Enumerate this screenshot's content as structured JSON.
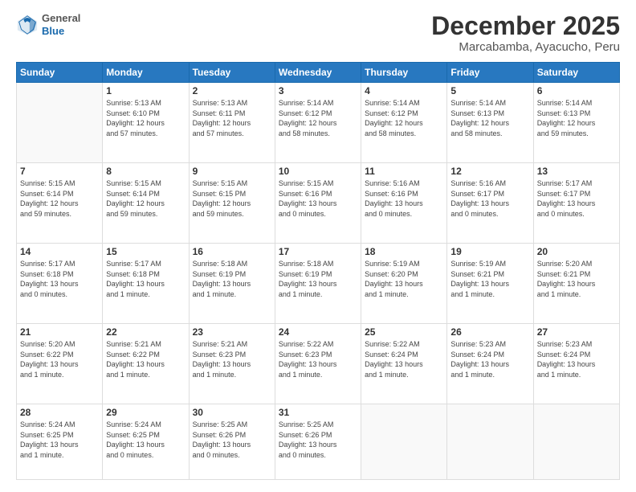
{
  "logo": {
    "general": "General",
    "blue": "Blue"
  },
  "header": {
    "month": "December 2025",
    "location": "Marcabamba, Ayacucho, Peru"
  },
  "weekdays": [
    "Sunday",
    "Monday",
    "Tuesday",
    "Wednesday",
    "Thursday",
    "Friday",
    "Saturday"
  ],
  "weeks": [
    [
      {
        "day": "",
        "info": ""
      },
      {
        "day": "1",
        "info": "Sunrise: 5:13 AM\nSunset: 6:10 PM\nDaylight: 12 hours\nand 57 minutes."
      },
      {
        "day": "2",
        "info": "Sunrise: 5:13 AM\nSunset: 6:11 PM\nDaylight: 12 hours\nand 57 minutes."
      },
      {
        "day": "3",
        "info": "Sunrise: 5:14 AM\nSunset: 6:12 PM\nDaylight: 12 hours\nand 58 minutes."
      },
      {
        "day": "4",
        "info": "Sunrise: 5:14 AM\nSunset: 6:12 PM\nDaylight: 12 hours\nand 58 minutes."
      },
      {
        "day": "5",
        "info": "Sunrise: 5:14 AM\nSunset: 6:13 PM\nDaylight: 12 hours\nand 58 minutes."
      },
      {
        "day": "6",
        "info": "Sunrise: 5:14 AM\nSunset: 6:13 PM\nDaylight: 12 hours\nand 59 minutes."
      }
    ],
    [
      {
        "day": "7",
        "info": "Sunrise: 5:15 AM\nSunset: 6:14 PM\nDaylight: 12 hours\nand 59 minutes."
      },
      {
        "day": "8",
        "info": "Sunrise: 5:15 AM\nSunset: 6:14 PM\nDaylight: 12 hours\nand 59 minutes."
      },
      {
        "day": "9",
        "info": "Sunrise: 5:15 AM\nSunset: 6:15 PM\nDaylight: 12 hours\nand 59 minutes."
      },
      {
        "day": "10",
        "info": "Sunrise: 5:15 AM\nSunset: 6:16 PM\nDaylight: 13 hours\nand 0 minutes."
      },
      {
        "day": "11",
        "info": "Sunrise: 5:16 AM\nSunset: 6:16 PM\nDaylight: 13 hours\nand 0 minutes."
      },
      {
        "day": "12",
        "info": "Sunrise: 5:16 AM\nSunset: 6:17 PM\nDaylight: 13 hours\nand 0 minutes."
      },
      {
        "day": "13",
        "info": "Sunrise: 5:17 AM\nSunset: 6:17 PM\nDaylight: 13 hours\nand 0 minutes."
      }
    ],
    [
      {
        "day": "14",
        "info": "Sunrise: 5:17 AM\nSunset: 6:18 PM\nDaylight: 13 hours\nand 0 minutes."
      },
      {
        "day": "15",
        "info": "Sunrise: 5:17 AM\nSunset: 6:18 PM\nDaylight: 13 hours\nand 1 minute."
      },
      {
        "day": "16",
        "info": "Sunrise: 5:18 AM\nSunset: 6:19 PM\nDaylight: 13 hours\nand 1 minute."
      },
      {
        "day": "17",
        "info": "Sunrise: 5:18 AM\nSunset: 6:19 PM\nDaylight: 13 hours\nand 1 minute."
      },
      {
        "day": "18",
        "info": "Sunrise: 5:19 AM\nSunset: 6:20 PM\nDaylight: 13 hours\nand 1 minute."
      },
      {
        "day": "19",
        "info": "Sunrise: 5:19 AM\nSunset: 6:21 PM\nDaylight: 13 hours\nand 1 minute."
      },
      {
        "day": "20",
        "info": "Sunrise: 5:20 AM\nSunset: 6:21 PM\nDaylight: 13 hours\nand 1 minute."
      }
    ],
    [
      {
        "day": "21",
        "info": "Sunrise: 5:20 AM\nSunset: 6:22 PM\nDaylight: 13 hours\nand 1 minute."
      },
      {
        "day": "22",
        "info": "Sunrise: 5:21 AM\nSunset: 6:22 PM\nDaylight: 13 hours\nand 1 minute."
      },
      {
        "day": "23",
        "info": "Sunrise: 5:21 AM\nSunset: 6:23 PM\nDaylight: 13 hours\nand 1 minute."
      },
      {
        "day": "24",
        "info": "Sunrise: 5:22 AM\nSunset: 6:23 PM\nDaylight: 13 hours\nand 1 minute."
      },
      {
        "day": "25",
        "info": "Sunrise: 5:22 AM\nSunset: 6:24 PM\nDaylight: 13 hours\nand 1 minute."
      },
      {
        "day": "26",
        "info": "Sunrise: 5:23 AM\nSunset: 6:24 PM\nDaylight: 13 hours\nand 1 minute."
      },
      {
        "day": "27",
        "info": "Sunrise: 5:23 AM\nSunset: 6:24 PM\nDaylight: 13 hours\nand 1 minute."
      }
    ],
    [
      {
        "day": "28",
        "info": "Sunrise: 5:24 AM\nSunset: 6:25 PM\nDaylight: 13 hours\nand 1 minute."
      },
      {
        "day": "29",
        "info": "Sunrise: 5:24 AM\nSunset: 6:25 PM\nDaylight: 13 hours\nand 0 minutes."
      },
      {
        "day": "30",
        "info": "Sunrise: 5:25 AM\nSunset: 6:26 PM\nDaylight: 13 hours\nand 0 minutes."
      },
      {
        "day": "31",
        "info": "Sunrise: 5:25 AM\nSunset: 6:26 PM\nDaylight: 13 hours\nand 0 minutes."
      },
      {
        "day": "",
        "info": ""
      },
      {
        "day": "",
        "info": ""
      },
      {
        "day": "",
        "info": ""
      }
    ]
  ]
}
